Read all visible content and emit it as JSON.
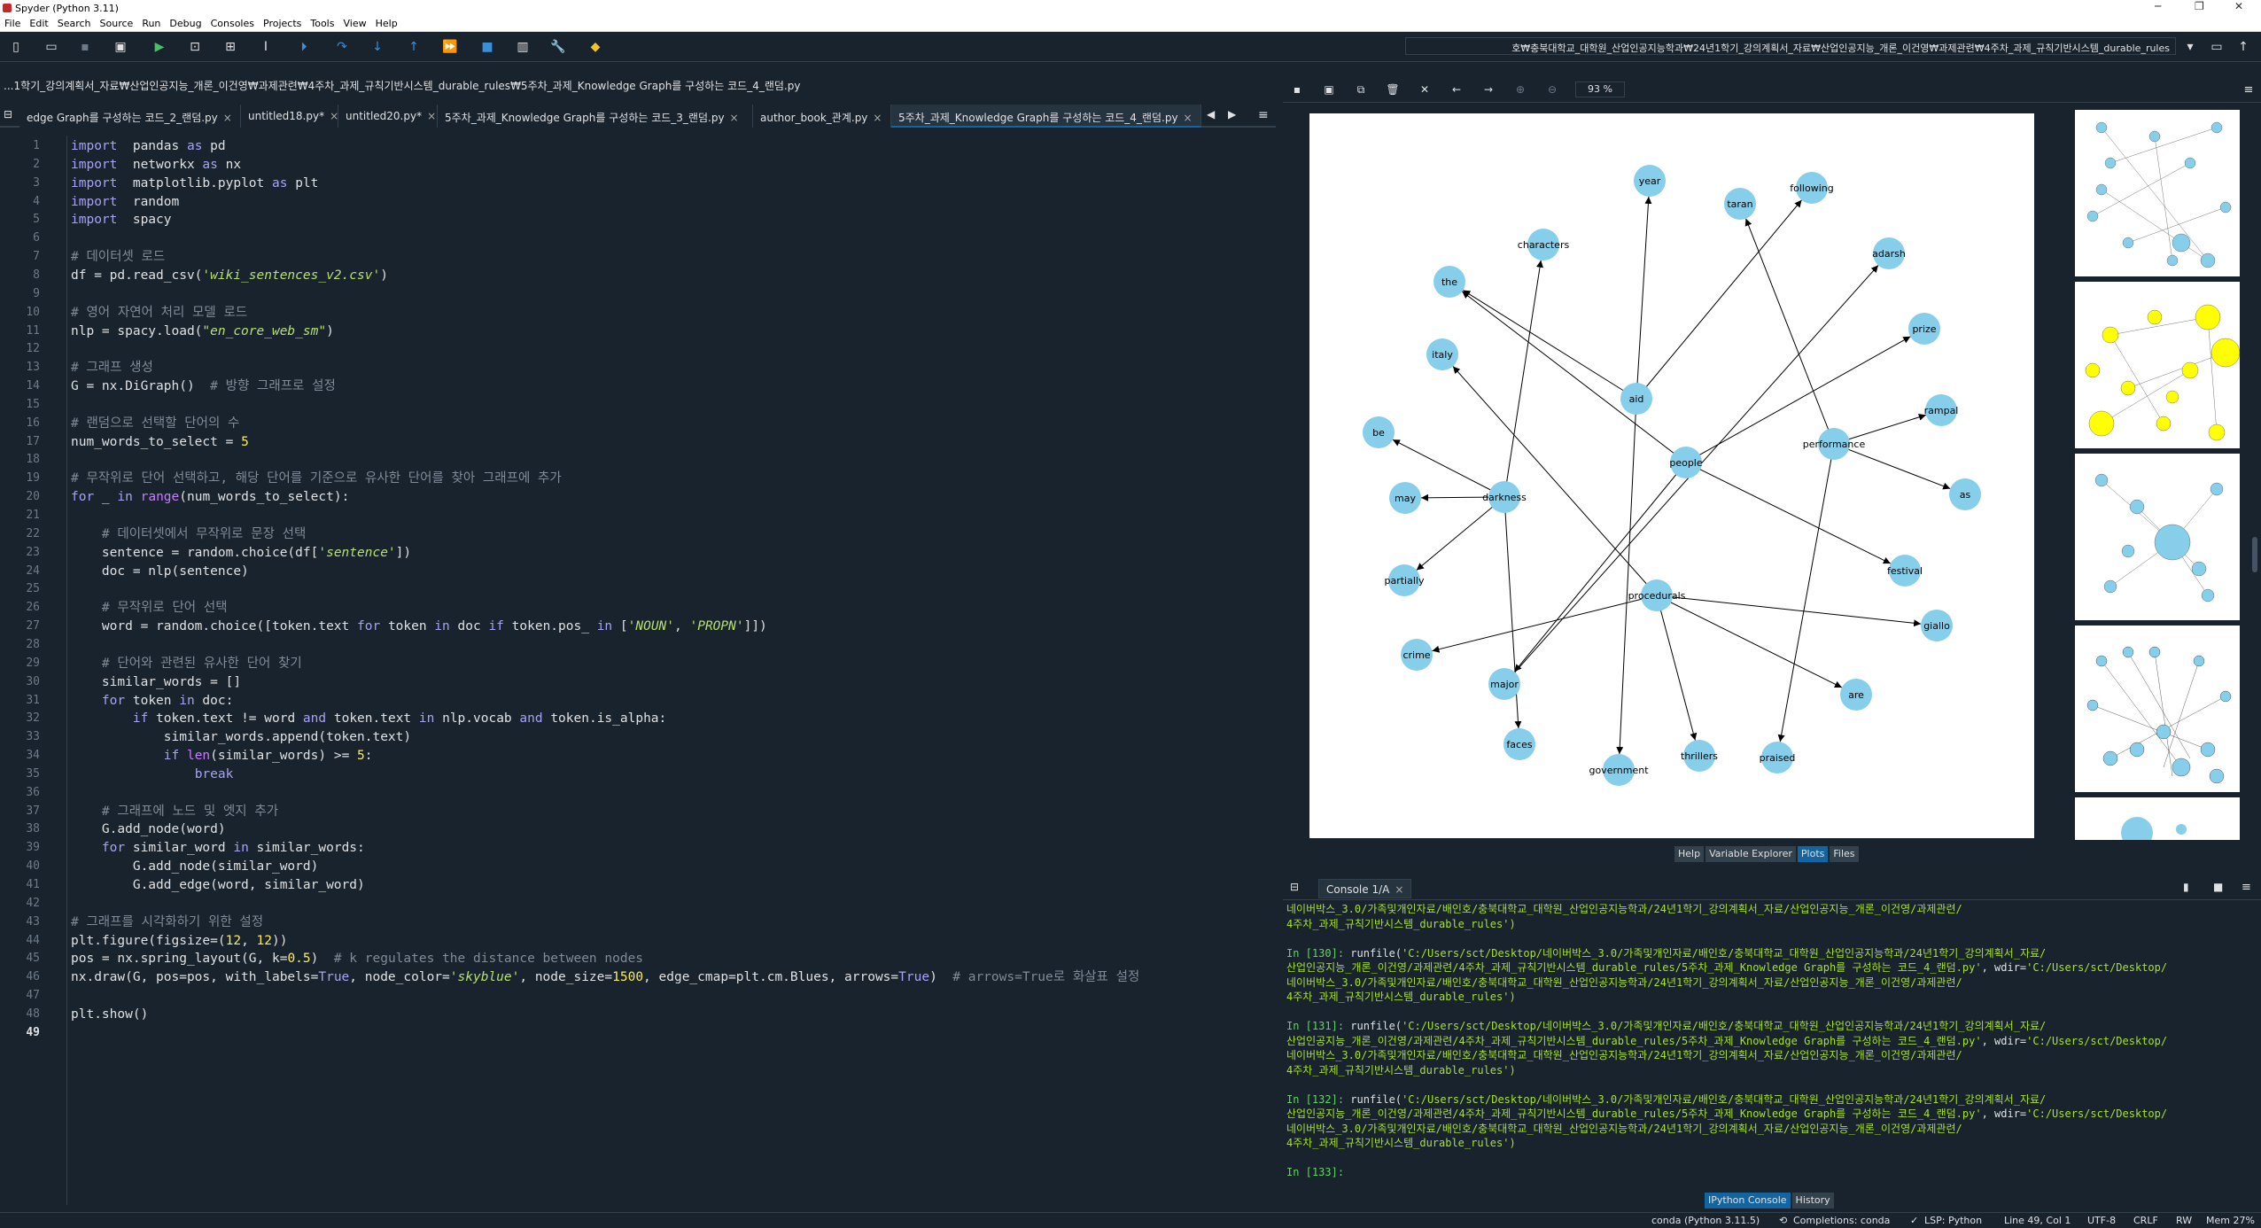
{
  "window": {
    "title": "Spyder (Python 3.11)",
    "controls": [
      "─",
      "❐",
      "✕"
    ]
  },
  "menu": [
    "File",
    "Edit",
    "Search",
    "Source",
    "Run",
    "Debug",
    "Consoles",
    "Projects",
    "Tools",
    "View",
    "Help"
  ],
  "toolbar": {
    "path": "호₩충북대학교_대학원_산업인공지능학과₩24년1학기_강의계획서_자료₩산업인공지능_개론_이건영₩과제관련₩4주차_과제_규칙기반시스템_durable_rules"
  },
  "editor": {
    "path": "...1학기_강의계획서_자료₩산업인공지능_개론_이건영₩과제관련₩4주차_과제_규칙기반시스템_durable_rules₩5주차_과제_Knowledge Graph를 구성하는 코드_4_랜덤.py",
    "tabs": [
      {
        "label": "edge Graph를 구성하는 코드_2_랜덤.py",
        "active": false
      },
      {
        "label": "untitled18.py*",
        "active": false
      },
      {
        "label": "untitled20.py*",
        "active": false
      },
      {
        "label": "5주차_과제_Knowledge Graph를 구성하는 코드_3_랜덤.py",
        "active": false
      },
      {
        "label": "author_book_관계.py",
        "active": false
      },
      {
        "label": "5주차_과제_Knowledge Graph를 구성하는 코드_4_랜덤.py",
        "active": true
      }
    ],
    "current_line": 49,
    "lines": [
      [
        [
          "kw",
          "import"
        ],
        [
          "",
          "  pandas "
        ],
        [
          "kw",
          "as"
        ],
        [
          "",
          " pd"
        ]
      ],
      [
        [
          "kw",
          "import"
        ],
        [
          "",
          "  networkx "
        ],
        [
          "kw",
          "as"
        ],
        [
          "",
          " nx"
        ]
      ],
      [
        [
          "kw",
          "import"
        ],
        [
          "",
          "  matplotlib.pyplot "
        ],
        [
          "kw",
          "as"
        ],
        [
          "",
          " plt"
        ]
      ],
      [
        [
          "kw",
          "import"
        ],
        [
          "",
          "  random"
        ]
      ],
      [
        [
          "kw",
          "import"
        ],
        [
          "",
          "  spacy"
        ]
      ],
      [],
      [
        [
          "cm",
          "# 데이터셋 로드"
        ]
      ],
      [
        [
          "",
          "df = pd.read_csv("
        ],
        [
          "str",
          "'wiki_sentences_v2.csv'"
        ],
        [
          "",
          ")"
        ]
      ],
      [],
      [
        [
          "cm",
          "# 영어 자연어 처리 모델 로드"
        ]
      ],
      [
        [
          "",
          "nlp = spacy.load("
        ],
        [
          "str",
          "\"en_core_web_sm\""
        ],
        [
          "",
          ")"
        ]
      ],
      [],
      [
        [
          "cm",
          "# 그래프 생성"
        ]
      ],
      [
        [
          "",
          "G = nx.DiGraph()  "
        ],
        [
          "cm",
          "# 방향 그래프로 설정"
        ]
      ],
      [],
      [
        [
          "cm",
          "# 랜덤으로 선택할 단어의 수"
        ]
      ],
      [
        [
          "",
          "num_words_to_select = "
        ],
        [
          "num",
          "5"
        ]
      ],
      [],
      [
        [
          "cm",
          "# 무작위로 단어 선택하고, 해당 단어를 기준으로 유사한 단어를 찾아 그래프에 추가"
        ]
      ],
      [
        [
          "kw",
          "for"
        ],
        [
          "",
          " _ "
        ],
        [
          "kw",
          "in"
        ],
        [
          "",
          " "
        ],
        [
          "bi",
          "range"
        ],
        [
          "",
          "(num_words_to_select):"
        ]
      ],
      [],
      [
        [
          "",
          "    "
        ],
        [
          "cm",
          "# 데이터셋에서 무작위로 문장 선택"
        ]
      ],
      [
        [
          "",
          "    sentence = random.choice(df["
        ],
        [
          "str",
          "'sentence'"
        ],
        [
          "",
          "])"
        ]
      ],
      [
        [
          "",
          "    doc = nlp(sentence)"
        ]
      ],
      [],
      [
        [
          "",
          "    "
        ],
        [
          "cm",
          "# 무작위로 단어 선택"
        ]
      ],
      [
        [
          "",
          "    word = random.choice([token.text "
        ],
        [
          "kw",
          "for"
        ],
        [
          "",
          " token "
        ],
        [
          "kw",
          "in"
        ],
        [
          "",
          " doc "
        ],
        [
          "kw",
          "if"
        ],
        [
          "",
          " token.pos_ "
        ],
        [
          "kw",
          "in"
        ],
        [
          "",
          " ["
        ],
        [
          "str",
          "'NOUN'"
        ],
        [
          "",
          ", "
        ],
        [
          "str",
          "'PROPN'"
        ],
        [
          "",
          "]])"
        ]
      ],
      [],
      [
        [
          "",
          "    "
        ],
        [
          "cm",
          "# 단어와 관련된 유사한 단어 찾기"
        ]
      ],
      [
        [
          "",
          "    similar_words = []"
        ]
      ],
      [
        [
          "",
          "    "
        ],
        [
          "kw",
          "for"
        ],
        [
          "",
          " token "
        ],
        [
          "kw",
          "in"
        ],
        [
          "",
          " doc:"
        ]
      ],
      [
        [
          "",
          "        "
        ],
        [
          "kw",
          "if"
        ],
        [
          "",
          " token.text != word "
        ],
        [
          "kw",
          "and"
        ],
        [
          "",
          " token.text "
        ],
        [
          "kw",
          "in"
        ],
        [
          "",
          " nlp.vocab "
        ],
        [
          "kw",
          "and"
        ],
        [
          "",
          " token.is_alpha:"
        ]
      ],
      [
        [
          "",
          "            similar_words.append(token.text)"
        ]
      ],
      [
        [
          "",
          "            "
        ],
        [
          "kw",
          "if"
        ],
        [
          "",
          " "
        ],
        [
          "bi",
          "len"
        ],
        [
          "",
          "(similar_words) >= "
        ],
        [
          "num",
          "5"
        ],
        [
          "",
          ":"
        ]
      ],
      [
        [
          "",
          "                "
        ],
        [
          "kw",
          "break"
        ]
      ],
      [],
      [
        [
          "",
          "    "
        ],
        [
          "cm",
          "# 그래프에 노드 및 엣지 추가"
        ]
      ],
      [
        [
          "",
          "    G.add_node(word)"
        ]
      ],
      [
        [
          "",
          "    "
        ],
        [
          "kw",
          "for"
        ],
        [
          "",
          " similar_word "
        ],
        [
          "kw",
          "in"
        ],
        [
          "",
          " similar_words:"
        ]
      ],
      [
        [
          "",
          "        G.add_node(similar_word)"
        ]
      ],
      [
        [
          "",
          "        G.add_edge(word, similar_word)"
        ]
      ],
      [],
      [
        [
          "cm",
          "# 그래프를 시각화하기 위한 설정"
        ]
      ],
      [
        [
          "",
          "plt.figure(figsize=("
        ],
        [
          "num",
          "12"
        ],
        [
          "",
          ", "
        ],
        [
          "num",
          "12"
        ],
        [
          "",
          "))"
        ]
      ],
      [
        [
          "",
          "pos = nx.spring_layout(G, k="
        ],
        [
          "num",
          "0.5"
        ],
        [
          "",
          ")  "
        ],
        [
          "cm",
          "# k regulates the distance between nodes"
        ]
      ],
      [
        [
          "",
          "nx.draw(G, pos=pos, with_labels="
        ],
        [
          "kw",
          "True"
        ],
        [
          "",
          ", node_color="
        ],
        [
          "str",
          "'skyblue'"
        ],
        [
          "",
          ", node_size="
        ],
        [
          "num",
          "1500"
        ],
        [
          "",
          ", edge_cmap=plt.cm.Blues, arrows="
        ],
        [
          "kw",
          "True"
        ],
        [
          "",
          ")  "
        ],
        [
          "cm",
          "# arrows=True로 화살표 설정"
        ]
      ],
      [],
      [
        [
          "",
          "plt.show()"
        ]
      ],
      []
    ]
  },
  "plots": {
    "zoom": "93 %",
    "graph": {
      "nodes": [
        {
          "id": "year"
        },
        {
          "id": "taran"
        },
        {
          "id": "following"
        },
        {
          "id": "characters"
        },
        {
          "id": "adarsh"
        },
        {
          "id": "the"
        },
        {
          "id": "prize"
        },
        {
          "id": "italy"
        },
        {
          "id": "aid"
        },
        {
          "id": "rampal"
        },
        {
          "id": "be"
        },
        {
          "id": "performance"
        },
        {
          "id": "people"
        },
        {
          "id": "may"
        },
        {
          "id": "darkness"
        },
        {
          "id": "as"
        },
        {
          "id": "partially"
        },
        {
          "id": "festival"
        },
        {
          "id": "procedurals"
        },
        {
          "id": "giallo"
        },
        {
          "id": "crime"
        },
        {
          "id": "major"
        },
        {
          "id": "are"
        },
        {
          "id": "faces"
        },
        {
          "id": "thrillers"
        },
        {
          "id": "praised"
        },
        {
          "id": "government"
        }
      ],
      "edges": [
        [
          "aid",
          "year"
        ],
        [
          "aid",
          "following"
        ],
        [
          "aid",
          "the"
        ],
        [
          "aid",
          "government"
        ],
        [
          "people",
          "the"
        ],
        [
          "people",
          "prize"
        ],
        [
          "people",
          "festival"
        ],
        [
          "people",
          "major"
        ],
        [
          "performance",
          "taran"
        ],
        [
          "performance",
          "rampal"
        ],
        [
          "performance",
          "as"
        ],
        [
          "performance",
          "praised"
        ],
        [
          "darkness",
          "be"
        ],
        [
          "darkness",
          "may"
        ],
        [
          "darkness",
          "partially"
        ],
        [
          "darkness",
          "characters"
        ],
        [
          "darkness",
          "faces"
        ],
        [
          "procedurals",
          "italy"
        ],
        [
          "procedurals",
          "crime"
        ],
        [
          "procedurals",
          "giallo"
        ],
        [
          "procedurals",
          "are"
        ],
        [
          "procedurals",
          "thrillers"
        ],
        [
          "major",
          "adarsh"
        ]
      ]
    },
    "pane_tabs": [
      "Help",
      "Variable Explorer",
      "Plots",
      "Files"
    ],
    "active_pane_tab": "Plots"
  },
  "console": {
    "tab_label": "Console 1/A",
    "lines": [
      [
        [
          "green",
          "네이버박스_3.0/가족및개인자료/배인호/충북대학교_대학원_산업인공지능학과/24년1학기_강의계획서_자료/산업인공지능_개론_이건영/과제관련/"
        ]
      ],
      [
        [
          "green",
          "4주차_과제_규칙기반시스템_durable_rules')"
        ]
      ],
      [],
      [
        [
          "prompt",
          "In ["
        ],
        [
          "prompt",
          "130"
        ],
        [
          "prompt",
          "]: "
        ],
        [
          "white",
          "runfile("
        ],
        [
          "green",
          "'C:/Users/sct/Desktop/네이버박스_3.0/가족및개인자료/배인호/충북대학교_대학원_산업인공지능학과/24년1학기_강의계획서_자료/"
        ]
      ],
      [
        [
          "green",
          "산업인공지능_개론_이건영/과제관련/4주차_과제_규칙기반시스템_durable_rules/5주차_과제_Knowledge Graph를 구성하는 코드_4_랜덤.py'"
        ],
        [
          "white",
          ", wdir="
        ],
        [
          "green",
          "'C:/Users/sct/Desktop/"
        ]
      ],
      [
        [
          "green",
          "네이버박스_3.0/가족및개인자료/배인호/충북대학교_대학원_산업인공지능학과/24년1학기_강의계획서_자료/산업인공지능_개론_이건영/과제관련/"
        ]
      ],
      [
        [
          "green",
          "4주차_과제_규칙기반시스템_durable_rules')"
        ]
      ],
      [],
      [
        [
          "prompt",
          "In ["
        ],
        [
          "prompt",
          "131"
        ],
        [
          "prompt",
          "]: "
        ],
        [
          "white",
          "runfile("
        ],
        [
          "green",
          "'C:/Users/sct/Desktop/네이버박스_3.0/가족및개인자료/배인호/충북대학교_대학원_산업인공지능학과/24년1학기_강의계획서_자료/"
        ]
      ],
      [
        [
          "green",
          "산업인공지능_개론_이건영/과제관련/4주차_과제_규칙기반시스템_durable_rules/5주차_과제_Knowledge Graph를 구성하는 코드_4_랜덤.py'"
        ],
        [
          "white",
          ", wdir="
        ],
        [
          "green",
          "'C:/Users/sct/Desktop/"
        ]
      ],
      [
        [
          "green",
          "네이버박스_3.0/가족및개인자료/배인호/충북대학교_대학원_산업인공지능학과/24년1학기_강의계획서_자료/산업인공지능_개론_이건영/과제관련/"
        ]
      ],
      [
        [
          "green",
          "4주차_과제_규칙기반시스템_durable_rules')"
        ]
      ],
      [],
      [
        [
          "prompt",
          "In ["
        ],
        [
          "prompt",
          "132"
        ],
        [
          "prompt",
          "]: "
        ],
        [
          "white",
          "runfile("
        ],
        [
          "green",
          "'C:/Users/sct/Desktop/네이버박스_3.0/가족및개인자료/배인호/충북대학교_대학원_산업인공지능학과/24년1학기_강의계획서_자료/"
        ]
      ],
      [
        [
          "green",
          "산업인공지능_개론_이건영/과제관련/4주차_과제_규칙기반시스템_durable_rules/5주차_과제_Knowledge Graph를 구성하는 코드_4_랜덤.py'"
        ],
        [
          "white",
          ", wdir="
        ],
        [
          "green",
          "'C:/Users/sct/Desktop/"
        ]
      ],
      [
        [
          "green",
          "네이버박스_3.0/가족및개인자료/배인호/충북대학교_대학원_산업인공지능학과/24년1학기_강의계획서_자료/산업인공지능_개론_이건영/과제관련/"
        ]
      ],
      [
        [
          "green",
          "4주차_과제_규칙기반시스템_durable_rules')"
        ]
      ],
      [],
      [
        [
          "prompt",
          "In ["
        ],
        [
          "prompt",
          "133"
        ],
        [
          "prompt",
          "]: "
        ]
      ]
    ],
    "bottom_tabs": [
      "IPython Console",
      "History"
    ],
    "active_bottom_tab": "IPython Console"
  },
  "statusbar": {
    "env": "conda (Python 3.11.5)",
    "completions": "Completions: conda",
    "lsp": "LSP: Python",
    "position": "Line 49, Col 1",
    "encoding": "UTF-8",
    "eol": "CRLF",
    "rw": "RW",
    "mem": "Mem 27%"
  },
  "colors": {
    "bg": "#19232d",
    "accent": "#1464a0",
    "node": "#87ceeb"
  }
}
